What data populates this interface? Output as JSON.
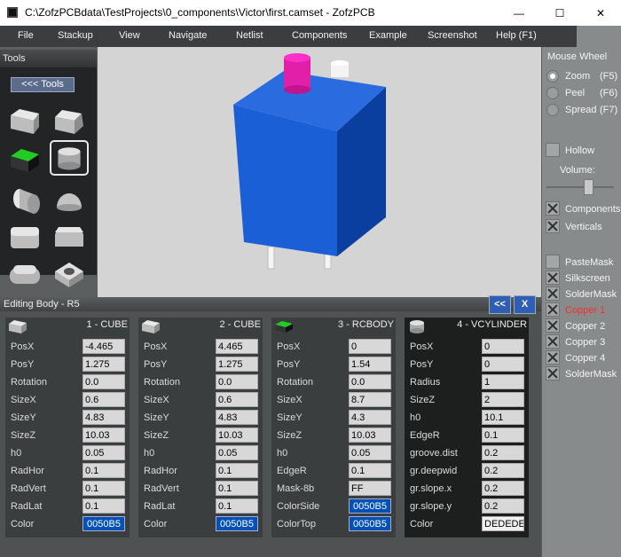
{
  "window": {
    "title": "C:\\ZofzPCBdata\\TestProjects\\0_components\\Victor\\first.camset - ZofzPCB",
    "min": "—",
    "max": "☐",
    "close": "✕"
  },
  "menu": [
    "File",
    "Stackup",
    "View",
    "Navigate",
    "Netlist",
    "Components",
    "Example",
    "Screenshot",
    "Help (F1)"
  ],
  "tools": {
    "title": "Tools",
    "back_label": "<<< Tools"
  },
  "mouse_wheel": {
    "title": "Mouse Wheel",
    "options": [
      {
        "label": "Zoom",
        "key": "(F5)",
        "selected": true
      },
      {
        "label": "Peel",
        "key": "(F6)",
        "selected": false
      },
      {
        "label": "Spread",
        "key": "(F7)",
        "selected": false
      }
    ],
    "hollow": "Hollow",
    "volume": "Volume:",
    "volume_level": 0.6,
    "toggles": [
      {
        "label": "Components",
        "checked": true
      },
      {
        "label": "Verticals",
        "checked": true
      }
    ],
    "layers": [
      {
        "label": "PasteMask",
        "checked": false,
        "color": "#ffffff"
      },
      {
        "label": "Silkscreen",
        "checked": true,
        "color": "#ffffff"
      },
      {
        "label": "SolderMask",
        "checked": true,
        "color": "#ffffff"
      },
      {
        "label": "Copper  1",
        "checked": true,
        "color": "#ff2a2a"
      },
      {
        "label": "Copper  2",
        "checked": true,
        "color": "#ffffff"
      },
      {
        "label": "Copper  3",
        "checked": true,
        "color": "#ffffff"
      },
      {
        "label": "Copper  4",
        "checked": true,
        "color": "#ffffff"
      },
      {
        "label": "SolderMask",
        "checked": true,
        "color": "#ffffff"
      }
    ]
  },
  "editor": {
    "title": "Editing Body - R5",
    "collapse": "<<",
    "close": "X",
    "columns": [
      {
        "title": "1 - CUBE",
        "rows": [
          {
            "label": "PosX",
            "value": "-4.465"
          },
          {
            "label": "PosY",
            "value": "1.275"
          },
          {
            "label": "Rotation",
            "value": "0.0"
          },
          {
            "label": "SizeX",
            "value": "0.6"
          },
          {
            "label": "SizeY",
            "value": "4.83"
          },
          {
            "label": "SizeZ",
            "value": "10.03"
          },
          {
            "label": "h0",
            "value": "0.05"
          },
          {
            "label": "RadHor",
            "value": "0.1"
          },
          {
            "label": "RadVert",
            "value": "0.1"
          },
          {
            "label": "RadLat",
            "value": "0.1"
          },
          {
            "label": "Color",
            "value": "0050B5"
          }
        ]
      },
      {
        "title": "2 - CUBE",
        "rows": [
          {
            "label": "PosX",
            "value": "4.465"
          },
          {
            "label": "PosY",
            "value": "1.275"
          },
          {
            "label": "Rotation",
            "value": "0.0"
          },
          {
            "label": "SizeX",
            "value": "0.6"
          },
          {
            "label": "SizeY",
            "value": "4.83"
          },
          {
            "label": "SizeZ",
            "value": "10.03"
          },
          {
            "label": "h0",
            "value": "0.05"
          },
          {
            "label": "RadHor",
            "value": "0.1"
          },
          {
            "label": "RadVert",
            "value": "0.1"
          },
          {
            "label": "RadLat",
            "value": "0.1"
          },
          {
            "label": "Color",
            "value": "0050B5"
          }
        ]
      },
      {
        "title": "3 - RCBODY",
        "rows": [
          {
            "label": "PosX",
            "value": "0"
          },
          {
            "label": "PosY",
            "value": "1.54"
          },
          {
            "label": "Rotation",
            "value": "0.0"
          },
          {
            "label": "SizeX",
            "value": "8.7"
          },
          {
            "label": "SizeY",
            "value": "4.3"
          },
          {
            "label": "SizeZ",
            "value": "10.03"
          },
          {
            "label": "h0",
            "value": "0.05"
          },
          {
            "label": "EdgeR",
            "value": "0.1"
          },
          {
            "label": "Mask-8b",
            "value": "FF"
          },
          {
            "label": "ColorSide",
            "value": "0050B5"
          },
          {
            "label": "ColorTop",
            "value": "0050B5"
          }
        ]
      },
      {
        "title": "4 - VCYLINDER",
        "rows": [
          {
            "label": "PosX",
            "value": "0"
          },
          {
            "label": "PosY",
            "value": "0"
          },
          {
            "label": "Radius",
            "value": "1"
          },
          {
            "label": "SizeZ",
            "value": "2"
          },
          {
            "label": "h0",
            "value": "10.1"
          },
          {
            "label": "EdgeR",
            "value": "0.1"
          },
          {
            "label": "groove.dist",
            "value": "0.2"
          },
          {
            "label": "gr.deepwid",
            "value": "0.2"
          },
          {
            "label": "gr.slope.x",
            "value": "0.2"
          },
          {
            "label": "gr.slope.y",
            "value": "0.2"
          },
          {
            "label": "Color",
            "value": "DEDEDE"
          }
        ]
      }
    ]
  }
}
